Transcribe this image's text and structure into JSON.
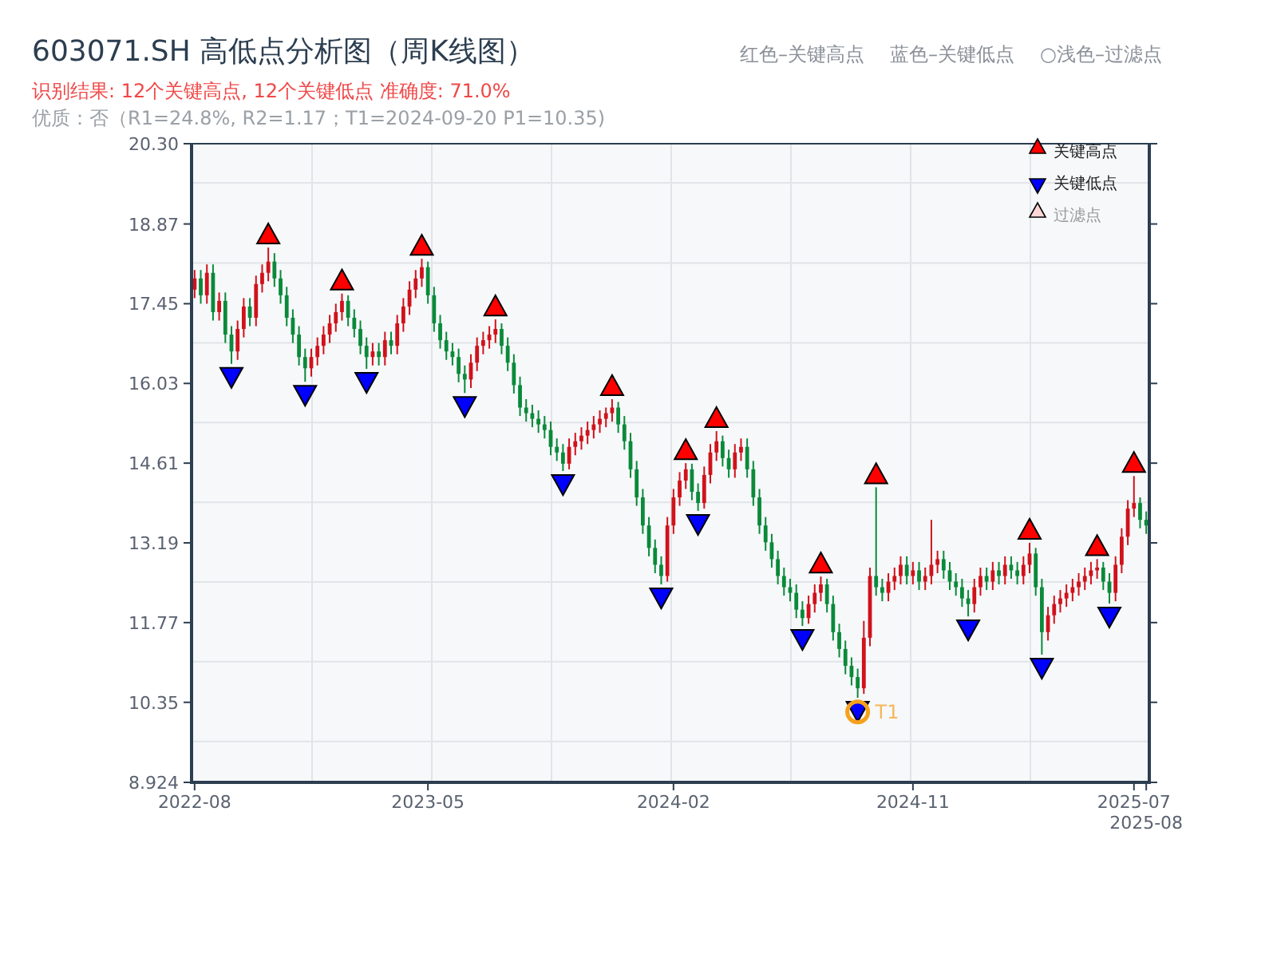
{
  "title": "603071.SH 高低点分析图（周K线图）",
  "hints": [
    "红色–关键高点",
    "蓝色–关键低点",
    "○浅色–过滤点"
  ],
  "result_line": "识别结果: 12个关键高点, 12个关键低点   准确度: 71.0%",
  "quality_line": "优质：否（R1=24.8%, R2=1.17；T1=2024-09-20 P1=10.35)",
  "filtered_legend": {
    "label": "过滤点",
    "color": "#ffd6d6"
  },
  "chart_data": {
    "type": "candlestick",
    "legend": "upper right",
    "ylim": [
      8.924,
      20.3
    ],
    "yticks": [
      {
        "value": 8.924,
        "label": "8.924"
      },
      {
        "value": 10.35,
        "label": "10.35"
      },
      {
        "value": 11.77,
        "label": "11.77"
      },
      {
        "value": 13.19,
        "label": "13.19"
      },
      {
        "value": 14.61,
        "label": "14.61"
      },
      {
        "value": 16.03,
        "label": "16.03"
      },
      {
        "value": 17.45,
        "label": "17.45"
      },
      {
        "value": 18.87,
        "label": "18.87"
      },
      {
        "value": 20.3,
        "label": "20.30"
      }
    ],
    "categories": [
      "2022-08",
      null,
      null,
      null,
      null,
      null,
      null,
      null,
      null,
      null,
      null,
      null,
      null,
      null,
      null,
      null,
      null,
      null,
      null,
      null,
      null,
      null,
      null,
      null,
      null,
      null,
      null,
      null,
      null,
      null,
      null,
      null,
      null,
      null,
      null,
      null,
      null,
      null,
      "2023-05",
      null,
      null,
      null,
      null,
      null,
      null,
      null,
      null,
      null,
      null,
      null,
      null,
      null,
      null,
      null,
      null,
      null,
      null,
      null,
      null,
      null,
      null,
      null,
      null,
      null,
      null,
      null,
      null,
      null,
      null,
      null,
      null,
      null,
      null,
      null,
      null,
      null,
      null,
      null,
      "2024-02",
      null,
      null,
      null,
      null,
      null,
      null,
      null,
      null,
      null,
      null,
      null,
      null,
      null,
      null,
      null,
      null,
      null,
      null,
      null,
      null,
      null,
      null,
      null,
      null,
      null,
      null,
      null,
      null,
      null,
      null,
      null,
      null,
      null,
      null,
      null,
      null,
      null,
      null,
      "2024-11",
      null,
      null,
      null,
      null,
      null,
      null,
      null,
      null,
      null,
      null,
      null,
      null,
      null,
      null,
      null,
      null,
      null,
      null,
      null,
      null,
      null,
      null,
      null,
      null,
      null,
      null,
      null,
      null,
      null,
      null,
      null,
      null,
      null,
      null,
      null,
      "2025-07",
      null,
      "2025-08"
    ],
    "ohlc": [
      [
        17.7,
        18.05,
        17.55,
        17.9
      ],
      [
        17.9,
        18.05,
        17.45,
        17.6
      ],
      [
        17.6,
        18.15,
        17.45,
        18.0
      ],
      [
        18.0,
        18.15,
        17.15,
        17.3
      ],
      [
        17.3,
        17.65,
        17.15,
        17.5
      ],
      [
        17.5,
        17.65,
        16.75,
        16.9
      ],
      [
        16.9,
        17.05,
        16.38,
        16.6
      ],
      [
        16.6,
        17.15,
        16.45,
        17.0
      ],
      [
        17.0,
        17.55,
        16.85,
        17.4
      ],
      [
        17.4,
        17.55,
        17.05,
        17.2
      ],
      [
        17.2,
        17.95,
        17.05,
        17.8
      ],
      [
        17.8,
        18.15,
        17.65,
        18.0
      ],
      [
        18.0,
        18.45,
        17.85,
        18.2
      ],
      [
        18.2,
        18.35,
        17.75,
        17.9
      ],
      [
        17.9,
        18.05,
        17.45,
        17.6
      ],
      [
        17.6,
        17.75,
        17.05,
        17.2
      ],
      [
        17.2,
        17.35,
        16.75,
        16.9
      ],
      [
        16.9,
        17.05,
        16.35,
        16.5
      ],
      [
        16.5,
        16.65,
        16.06,
        16.3
      ],
      [
        16.3,
        16.65,
        16.15,
        16.5
      ],
      [
        16.5,
        16.85,
        16.35,
        16.7
      ],
      [
        16.7,
        17.05,
        16.55,
        16.9
      ],
      [
        16.9,
        17.25,
        16.75,
        17.1
      ],
      [
        17.1,
        17.45,
        16.95,
        17.3
      ],
      [
        17.3,
        17.63,
        17.15,
        17.5
      ],
      [
        17.5,
        17.6,
        17.05,
        17.2
      ],
      [
        17.2,
        17.35,
        16.85,
        17.0
      ],
      [
        17.0,
        17.15,
        16.55,
        16.7
      ],
      [
        16.7,
        16.85,
        16.29,
        16.5
      ],
      [
        16.5,
        16.75,
        16.35,
        16.6
      ],
      [
        16.6,
        16.75,
        16.35,
        16.5
      ],
      [
        16.5,
        16.95,
        16.35,
        16.8
      ],
      [
        16.8,
        16.95,
        16.55,
        16.7
      ],
      [
        16.7,
        17.25,
        16.55,
        17.1
      ],
      [
        17.1,
        17.55,
        16.95,
        17.4
      ],
      [
        17.4,
        17.85,
        17.25,
        17.7
      ],
      [
        17.7,
        18.05,
        17.55,
        17.9
      ],
      [
        17.9,
        18.25,
        17.75,
        18.1
      ],
      [
        18.1,
        18.2,
        17.45,
        17.6
      ],
      [
        17.6,
        17.75,
        16.95,
        17.1
      ],
      [
        17.1,
        17.25,
        16.65,
        16.8
      ],
      [
        16.8,
        16.95,
        16.45,
        16.6
      ],
      [
        16.6,
        16.75,
        16.35,
        16.5
      ],
      [
        16.5,
        16.65,
        16.05,
        16.2
      ],
      [
        16.2,
        16.35,
        15.86,
        16.1
      ],
      [
        16.1,
        16.55,
        15.95,
        16.4
      ],
      [
        16.4,
        16.85,
        16.25,
        16.7
      ],
      [
        16.7,
        16.95,
        16.55,
        16.8
      ],
      [
        16.8,
        17.05,
        16.65,
        16.9
      ],
      [
        16.9,
        17.17,
        16.75,
        17.0
      ],
      [
        17.0,
        17.1,
        16.55,
        16.7
      ],
      [
        16.7,
        16.85,
        16.25,
        16.4
      ],
      [
        16.4,
        16.55,
        15.85,
        16.0
      ],
      [
        16.0,
        16.15,
        15.45,
        15.6
      ],
      [
        15.6,
        15.75,
        15.35,
        15.5
      ],
      [
        15.5,
        15.65,
        15.25,
        15.4
      ],
      [
        15.4,
        15.55,
        15.15,
        15.3
      ],
      [
        15.3,
        15.45,
        15.05,
        15.2
      ],
      [
        15.2,
        15.35,
        14.75,
        14.9
      ],
      [
        14.9,
        15.05,
        14.65,
        14.8
      ],
      [
        14.8,
        14.95,
        14.47,
        14.6
      ],
      [
        14.6,
        15.05,
        14.5,
        14.9
      ],
      [
        14.9,
        15.15,
        14.75,
        15.0
      ],
      [
        15.0,
        15.25,
        14.85,
        15.1
      ],
      [
        15.1,
        15.35,
        14.95,
        15.2
      ],
      [
        15.2,
        15.45,
        15.05,
        15.3
      ],
      [
        15.3,
        15.55,
        15.15,
        15.4
      ],
      [
        15.4,
        15.6,
        15.25,
        15.5
      ],
      [
        15.5,
        15.75,
        15.35,
        15.6
      ],
      [
        15.6,
        15.7,
        15.15,
        15.3
      ],
      [
        15.3,
        15.45,
        14.85,
        15.0
      ],
      [
        15.0,
        15.15,
        14.35,
        14.5
      ],
      [
        14.5,
        14.65,
        13.85,
        14.0
      ],
      [
        14.0,
        14.15,
        13.35,
        13.5
      ],
      [
        13.5,
        13.65,
        12.95,
        13.1
      ],
      [
        13.1,
        13.25,
        12.65,
        12.8
      ],
      [
        12.8,
        12.95,
        12.45,
        12.6
      ],
      [
        12.6,
        13.65,
        12.5,
        13.5
      ],
      [
        13.5,
        14.15,
        13.35,
        14.0
      ],
      [
        14.0,
        14.45,
        13.85,
        14.3
      ],
      [
        14.3,
        14.61,
        14.15,
        14.5
      ],
      [
        14.5,
        14.6,
        13.95,
        14.1
      ],
      [
        14.1,
        14.25,
        13.76,
        13.9
      ],
      [
        13.9,
        14.55,
        13.8,
        14.4
      ],
      [
        14.4,
        14.95,
        14.25,
        14.8
      ],
      [
        14.8,
        15.18,
        14.65,
        15.0
      ],
      [
        15.0,
        15.1,
        14.55,
        14.7
      ],
      [
        14.7,
        14.85,
        14.35,
        14.5
      ],
      [
        14.5,
        14.95,
        14.35,
        14.8
      ],
      [
        14.8,
        15.05,
        14.65,
        14.9
      ],
      [
        14.9,
        15.05,
        14.35,
        14.5
      ],
      [
        14.5,
        14.65,
        13.85,
        14.0
      ],
      [
        14.0,
        14.15,
        13.35,
        13.5
      ],
      [
        13.5,
        13.65,
        13.05,
        13.2
      ],
      [
        13.2,
        13.35,
        12.75,
        12.9
      ],
      [
        12.9,
        13.05,
        12.45,
        12.6
      ],
      [
        12.6,
        12.75,
        12.25,
        12.4
      ],
      [
        12.4,
        12.55,
        12.15,
        12.3
      ],
      [
        12.3,
        12.45,
        11.85,
        12.0
      ],
      [
        12.0,
        12.15,
        11.71,
        11.85
      ],
      [
        11.85,
        12.25,
        11.75,
        12.1
      ],
      [
        12.1,
        12.45,
        11.95,
        12.3
      ],
      [
        12.3,
        12.59,
        12.15,
        12.45
      ],
      [
        12.45,
        12.55,
        11.95,
        12.1
      ],
      [
        12.1,
        12.25,
        11.45,
        11.6
      ],
      [
        11.6,
        11.75,
        11.15,
        11.3
      ],
      [
        11.3,
        11.45,
        10.85,
        11.0
      ],
      [
        11.0,
        11.15,
        10.65,
        10.8
      ],
      [
        10.8,
        10.95,
        10.43,
        10.6
      ],
      [
        10.6,
        11.8,
        10.5,
        11.5
      ],
      [
        11.5,
        12.75,
        11.35,
        12.6
      ],
      [
        12.6,
        14.18,
        12.25,
        12.4
      ],
      [
        12.4,
        12.55,
        12.15,
        12.3
      ],
      [
        12.3,
        12.65,
        12.15,
        12.5
      ],
      [
        12.5,
        12.75,
        12.35,
        12.6
      ],
      [
        12.6,
        12.95,
        12.45,
        12.8
      ],
      [
        12.8,
        12.95,
        12.45,
        12.6
      ],
      [
        12.6,
        12.85,
        12.45,
        12.7
      ],
      [
        12.7,
        12.85,
        12.35,
        12.5
      ],
      [
        12.5,
        12.75,
        12.35,
        12.6
      ],
      [
        12.6,
        13.6,
        12.45,
        12.8
      ],
      [
        12.8,
        13.05,
        12.65,
        12.9
      ],
      [
        12.9,
        13.05,
        12.55,
        12.7
      ],
      [
        12.7,
        12.85,
        12.35,
        12.5
      ],
      [
        12.5,
        12.65,
        12.25,
        12.4
      ],
      [
        12.4,
        12.55,
        12.05,
        12.2
      ],
      [
        12.2,
        12.35,
        11.88,
        12.1
      ],
      [
        12.1,
        12.55,
        11.95,
        12.4
      ],
      [
        12.4,
        12.75,
        12.25,
        12.6
      ],
      [
        12.6,
        12.75,
        12.35,
        12.5
      ],
      [
        12.5,
        12.85,
        12.35,
        12.7
      ],
      [
        12.7,
        12.85,
        12.45,
        12.6
      ],
      [
        12.6,
        12.95,
        12.45,
        12.8
      ],
      [
        12.8,
        12.95,
        12.55,
        12.7
      ],
      [
        12.7,
        12.85,
        12.45,
        12.6
      ],
      [
        12.6,
        12.95,
        12.45,
        12.8
      ],
      [
        12.8,
        13.19,
        12.65,
        13.0
      ],
      [
        13.0,
        13.1,
        12.25,
        12.4
      ],
      [
        12.4,
        12.55,
        11.2,
        11.6
      ],
      [
        11.6,
        12.05,
        11.45,
        11.9
      ],
      [
        11.9,
        12.25,
        11.75,
        12.1
      ],
      [
        12.1,
        12.35,
        11.95,
        12.2
      ],
      [
        12.2,
        12.45,
        12.05,
        12.3
      ],
      [
        12.3,
        12.55,
        12.15,
        12.4
      ],
      [
        12.4,
        12.65,
        12.25,
        12.5
      ],
      [
        12.5,
        12.75,
        12.35,
        12.6
      ],
      [
        12.6,
        12.85,
        12.45,
        12.7
      ],
      [
        12.7,
        12.9,
        12.55,
        12.75
      ],
      [
        12.75,
        12.85,
        12.35,
        12.5
      ],
      [
        12.5,
        12.65,
        12.11,
        12.3
      ],
      [
        12.3,
        12.95,
        12.15,
        12.8
      ],
      [
        12.8,
        13.45,
        12.65,
        13.3
      ],
      [
        13.3,
        13.95,
        13.15,
        13.8
      ],
      [
        13.8,
        14.38,
        13.65,
        13.9
      ],
      [
        13.9,
        14.0,
        13.45,
        13.6
      ],
      [
        13.6,
        13.75,
        13.35,
        13.5
      ]
    ],
    "series": [
      {
        "name": "关键高点",
        "type": "scatter",
        "color": "#ff0000",
        "values": [
          null,
          null,
          null,
          null,
          null,
          null,
          null,
          null,
          null,
          null,
          null,
          null,
          18.7,
          null,
          null,
          null,
          null,
          null,
          null,
          null,
          null,
          null,
          null,
          null,
          17.88,
          null,
          null,
          null,
          null,
          null,
          null,
          null,
          null,
          null,
          null,
          null,
          null,
          18.5,
          null,
          null,
          null,
          null,
          null,
          null,
          null,
          null,
          null,
          null,
          null,
          17.42,
          null,
          null,
          null,
          null,
          null,
          null,
          null,
          null,
          null,
          null,
          null,
          null,
          null,
          null,
          null,
          null,
          null,
          null,
          16.0,
          null,
          null,
          null,
          null,
          null,
          null,
          null,
          null,
          null,
          null,
          null,
          14.86,
          null,
          null,
          null,
          null,
          15.43,
          null,
          null,
          null,
          null,
          null,
          null,
          null,
          null,
          null,
          null,
          null,
          null,
          null,
          null,
          null,
          null,
          12.84,
          null,
          null,
          null,
          null,
          null,
          null,
          null,
          null,
          14.43,
          null,
          null,
          null,
          null,
          null,
          null,
          null,
          null,
          null,
          null,
          null,
          null,
          null,
          null,
          null,
          null,
          null,
          null,
          null,
          null,
          null,
          null,
          null,
          null,
          13.44,
          null,
          null,
          null,
          null,
          null,
          null,
          null,
          null,
          null,
          null,
          13.15,
          null,
          null,
          null,
          null,
          null,
          14.63,
          null,
          null
        ]
      },
      {
        "name": "关键低点",
        "type": "scatter",
        "color": "#0000ff",
        "values": [
          null,
          null,
          null,
          null,
          null,
          null,
          16.13,
          null,
          null,
          null,
          null,
          null,
          null,
          null,
          null,
          null,
          null,
          null,
          15.81,
          null,
          null,
          null,
          null,
          null,
          null,
          null,
          null,
          null,
          16.04,
          null,
          null,
          null,
          null,
          null,
          null,
          null,
          null,
          null,
          null,
          null,
          null,
          null,
          null,
          null,
          15.61,
          null,
          null,
          null,
          null,
          null,
          null,
          null,
          null,
          null,
          null,
          null,
          null,
          null,
          null,
          null,
          14.22,
          null,
          null,
          null,
          null,
          null,
          null,
          null,
          null,
          null,
          null,
          null,
          null,
          null,
          null,
          null,
          12.2,
          null,
          null,
          null,
          null,
          null,
          13.51,
          null,
          null,
          null,
          null,
          null,
          null,
          null,
          null,
          null,
          null,
          null,
          null,
          null,
          null,
          null,
          null,
          11.46,
          null,
          null,
          null,
          null,
          null,
          null,
          null,
          null,
          10.18,
          null,
          null,
          null,
          null,
          null,
          null,
          null,
          null,
          null,
          null,
          null,
          null,
          null,
          null,
          null,
          null,
          null,
          11.63,
          null,
          null,
          null,
          null,
          null,
          null,
          null,
          null,
          null,
          null,
          null,
          10.95,
          null,
          null,
          null,
          null,
          null,
          null,
          null,
          null,
          null,
          null,
          11.86,
          null,
          null,
          null,
          null,
          null,
          null
        ]
      }
    ],
    "annotations": [
      "T1"
    ]
  }
}
